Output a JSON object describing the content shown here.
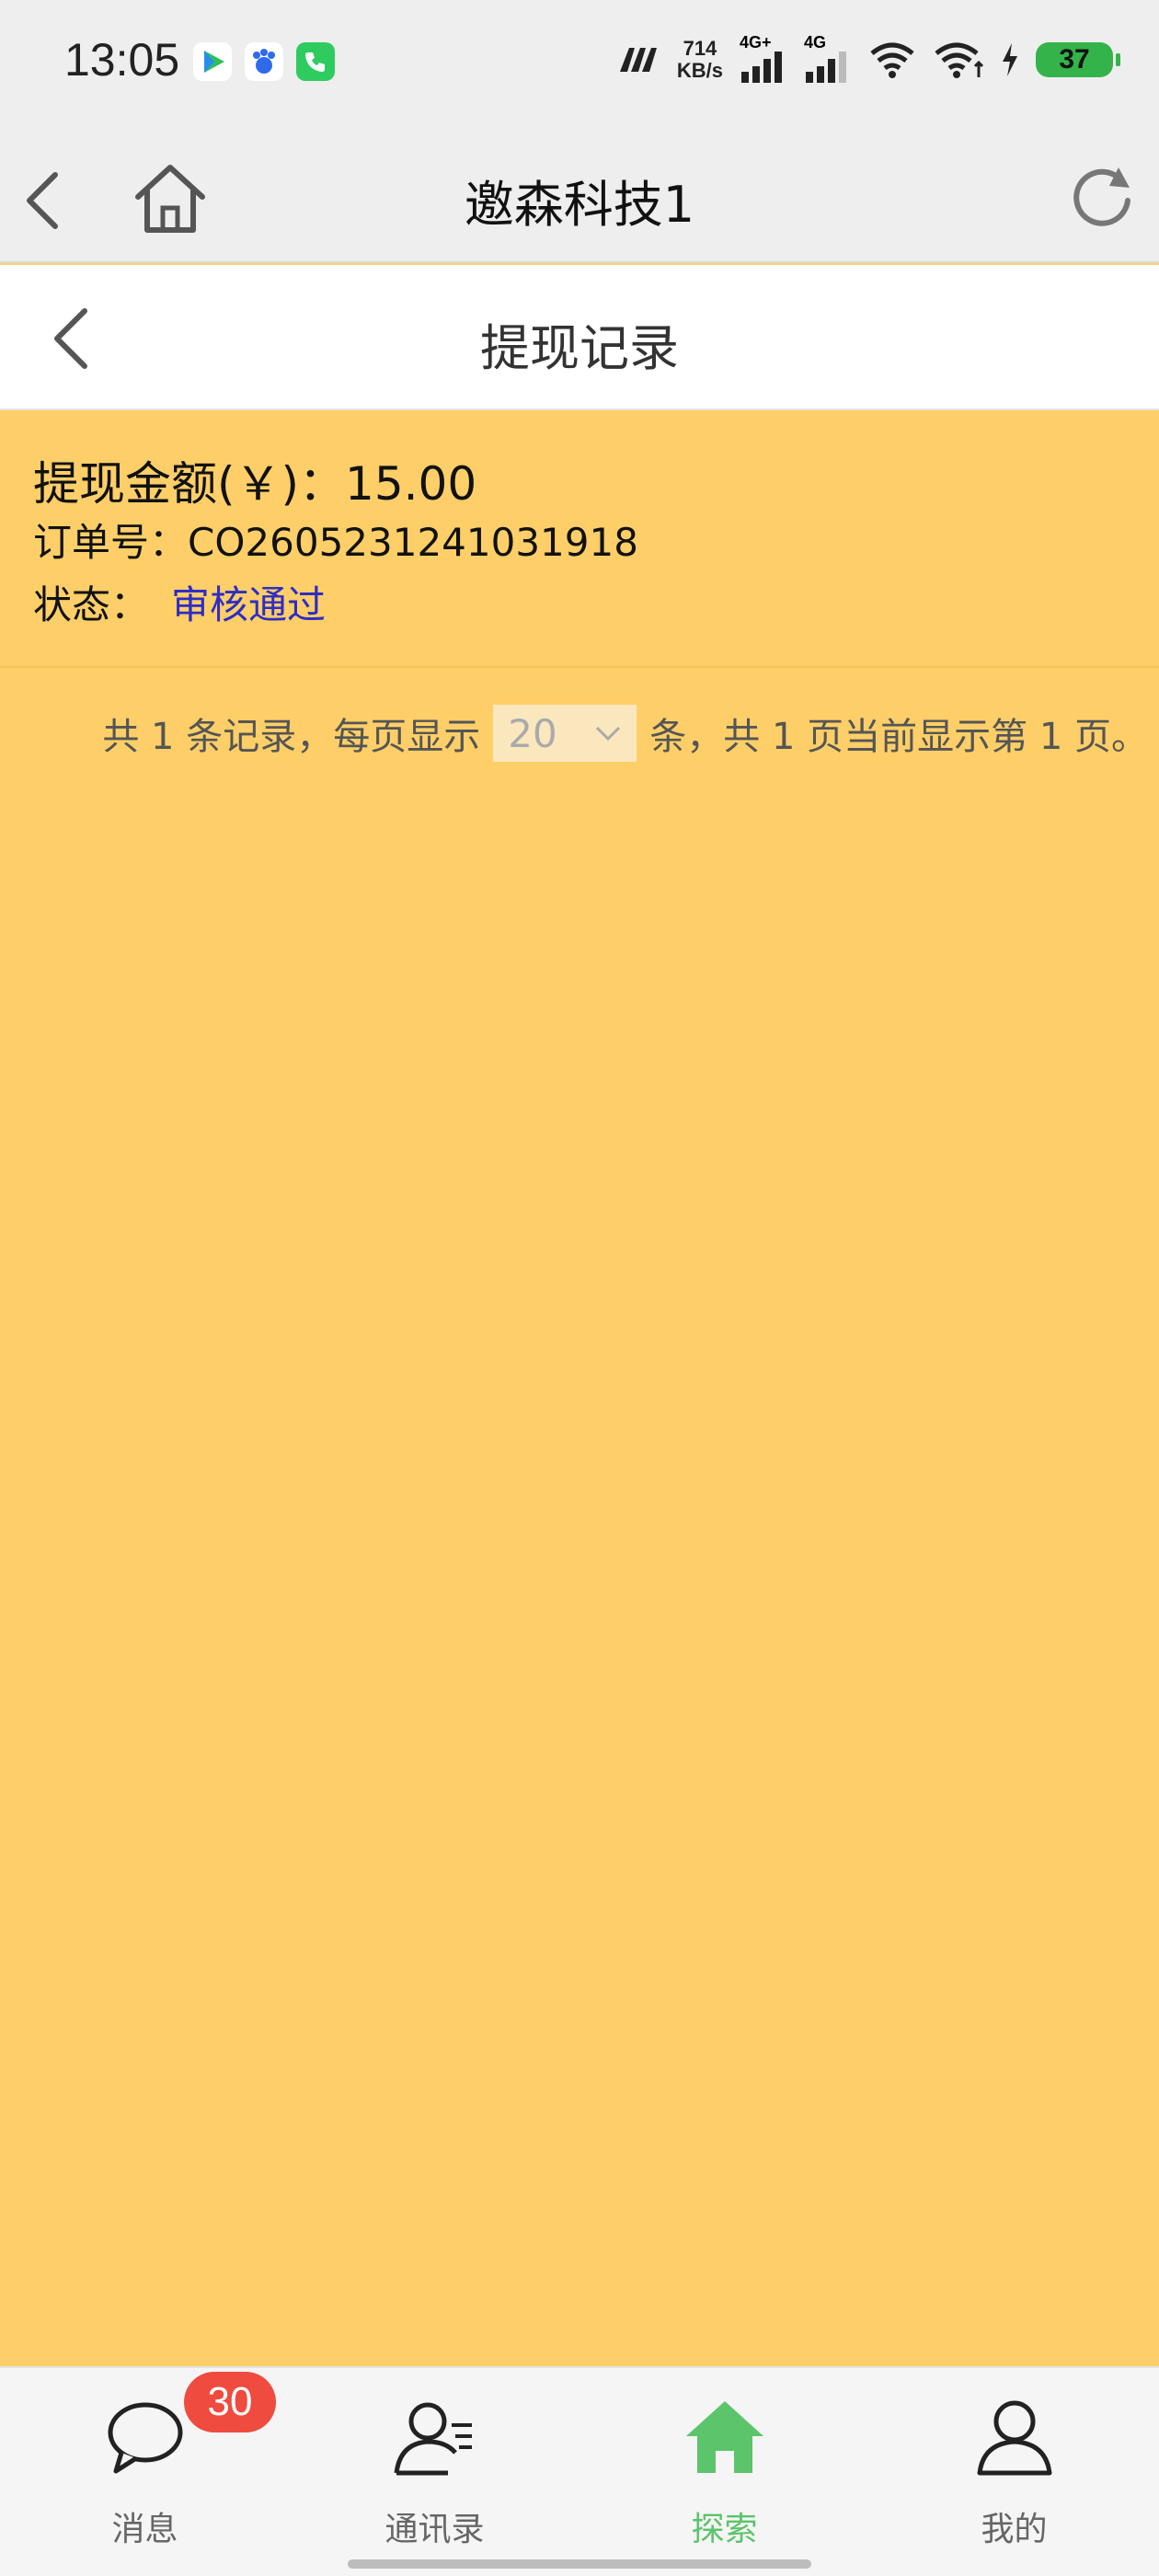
{
  "status_bar": {
    "time": "13:05",
    "net_speed_value": "714",
    "net_speed_unit": "KB/s",
    "signal1_label": "4G+",
    "signal2_label": "4G",
    "battery": "37",
    "icons": [
      "play-app-icon",
      "baidu-app-icon",
      "phone-app-icon",
      "mi-icon",
      "signal-icon",
      "wifi-icon",
      "charging-icon"
    ]
  },
  "app_bar": {
    "title": "邀森科技1"
  },
  "page": {
    "title": "提现记录"
  },
  "record": {
    "amount_text": "提现金额(￥)：15.00",
    "order_label": "订单号：",
    "order_no": "CO2605231241031918",
    "status_label": "状态：",
    "status_value": "审核通过"
  },
  "pagination": {
    "prefix": "共 1 条记录，每页显示",
    "page_size": "20",
    "suffix": "条，共 1 页当前显示第 1 页。"
  },
  "bottom_nav": {
    "items": [
      {
        "label": "消息",
        "badge": "30"
      },
      {
        "label": "通讯录"
      },
      {
        "label": "探索"
      },
      {
        "label": "我的"
      }
    ],
    "active_color": "#5cc46a"
  },
  "colors": {
    "background": "#fecf68",
    "status_link": "#2f2dc4",
    "badge": "#ef4b3f"
  }
}
